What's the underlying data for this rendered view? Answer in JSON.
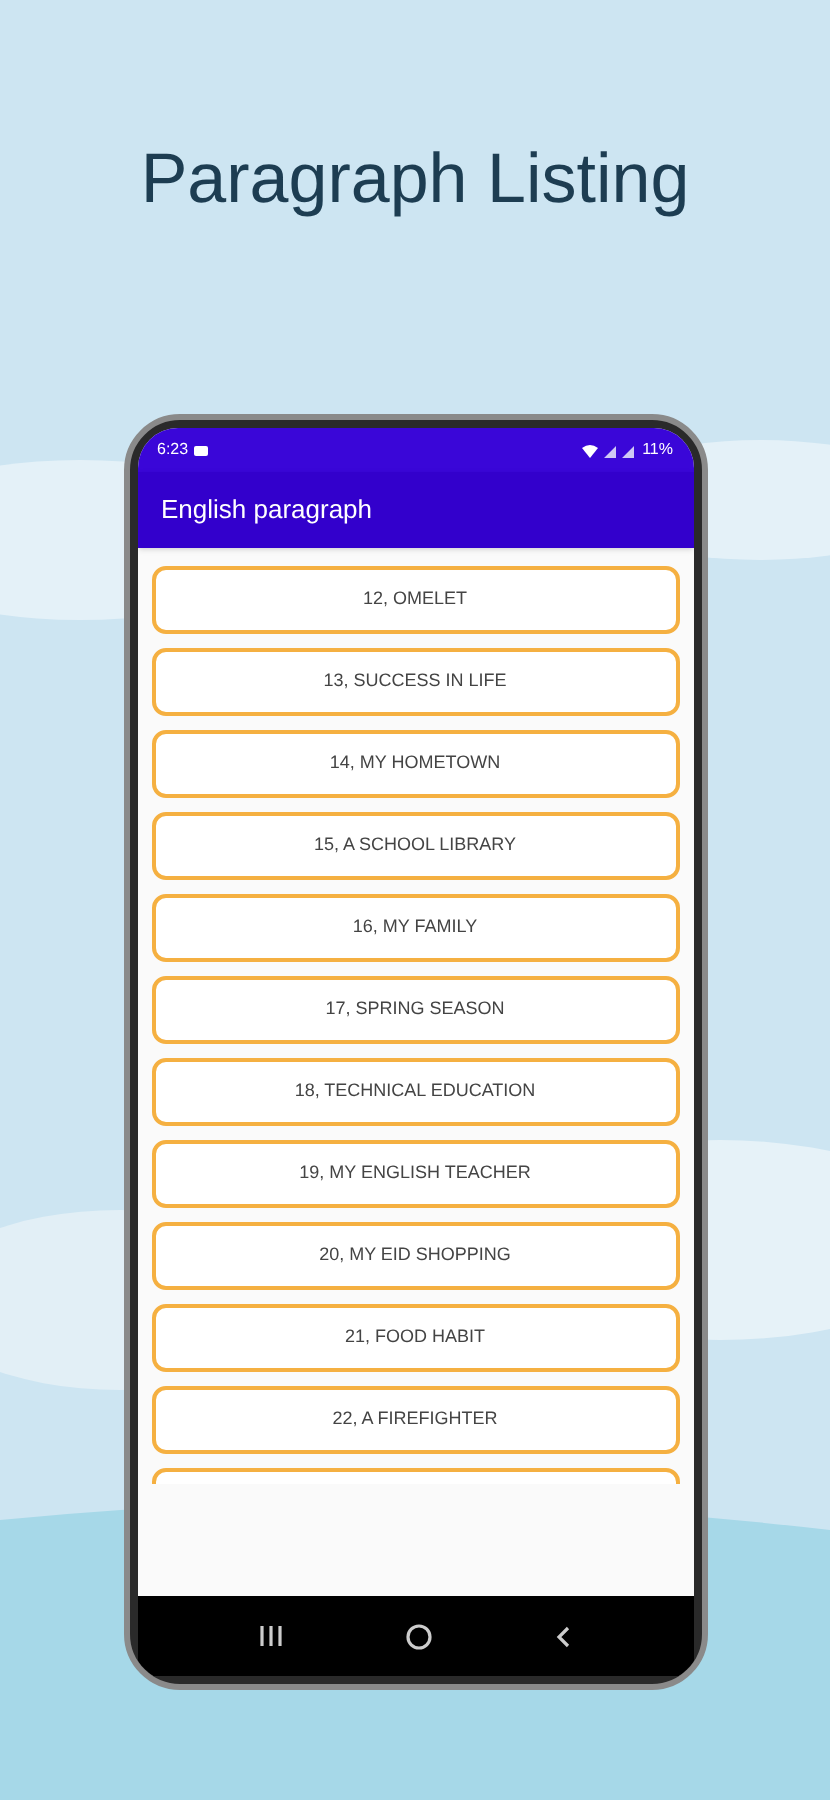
{
  "headline": "Paragraph Listing",
  "status_bar": {
    "time": "6:23",
    "battery": "11%"
  },
  "app_bar": {
    "title": "English paragraph"
  },
  "items": [
    {
      "label": "12, OMELET"
    },
    {
      "label": "13, SUCCESS IN LIFE"
    },
    {
      "label": "14, MY HOMETOWN"
    },
    {
      "label": "15, A SCHOOL LIBRARY"
    },
    {
      "label": "16, MY FAMILY"
    },
    {
      "label": "17, SPRING SEASON"
    },
    {
      "label": "18, TECHNICAL EDUCATION"
    },
    {
      "label": "19, MY ENGLISH TEACHER"
    },
    {
      "label": "20, MY EID SHOPPING"
    },
    {
      "label": "21, FOOD HABIT"
    },
    {
      "label": "22, A FIREFIGHTER"
    }
  ]
}
